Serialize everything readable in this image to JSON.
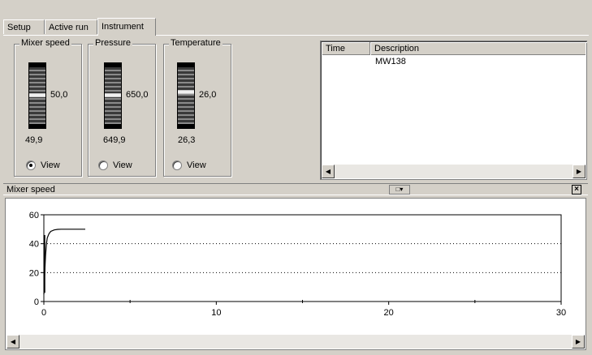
{
  "tabs": [
    {
      "label": "Setup",
      "active": false
    },
    {
      "label": "Active run",
      "active": false
    },
    {
      "label": "Instrument",
      "active": true
    }
  ],
  "gauges": [
    {
      "title": "Mixer speed",
      "value": "50,0",
      "reading": "49,9",
      "view_label": "View",
      "view_selected": true,
      "level": 0.55
    },
    {
      "title": "Pressure",
      "value": "650,0",
      "reading": "649,9",
      "view_label": "View",
      "view_selected": false,
      "level": 0.55
    },
    {
      "title": "Temperature",
      "value": "26,0",
      "reading": "26,3",
      "view_label": "View",
      "view_selected": false,
      "level": 0.6
    }
  ],
  "log": {
    "columns": [
      "Time",
      "Description"
    ],
    "rows": [
      {
        "time": "",
        "description": "MW138"
      }
    ]
  },
  "chart_window": {
    "title": "Mixer speed",
    "toolbar_icon": "chart-options-icon",
    "close_icon": "close-icon"
  },
  "chart_data": {
    "type": "line",
    "title": "",
    "xlabel": "",
    "ylabel": "",
    "xlim": [
      0,
      30
    ],
    "ylim": [
      0,
      60
    ],
    "x_ticks": [
      0,
      10,
      20,
      30
    ],
    "y_ticks": [
      0,
      20,
      40,
      60
    ],
    "grid": "dotted horizontal at 20 and 40",
    "series": [
      {
        "color": "#000000",
        "x": [
          0,
          0.05,
          0.1,
          0.15,
          0.2,
          0.3,
          0.4,
          0.6,
          0.8,
          1.0,
          1.5,
          2.0,
          2.4
        ],
        "y": [
          5,
          20,
          32,
          40,
          44,
          47,
          48.5,
          49.5,
          49.9,
          50,
          50,
          50,
          50
        ]
      }
    ]
  }
}
